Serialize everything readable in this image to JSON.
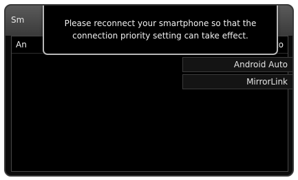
{
  "screen": {
    "title_partial": "Sm"
  },
  "header_row": {
    "left_partial": "An",
    "right_partial": "to"
  },
  "options": [
    {
      "label": "Android Auto"
    },
    {
      "label": "MirrorLink"
    }
  ],
  "popup": {
    "message": "Please reconnect your smartphone so that the connection priority setting can take effect."
  },
  "colors": {
    "background": "#0c0c0c",
    "popup_border": "#b9b9b9",
    "text": "#f0f0f0"
  }
}
